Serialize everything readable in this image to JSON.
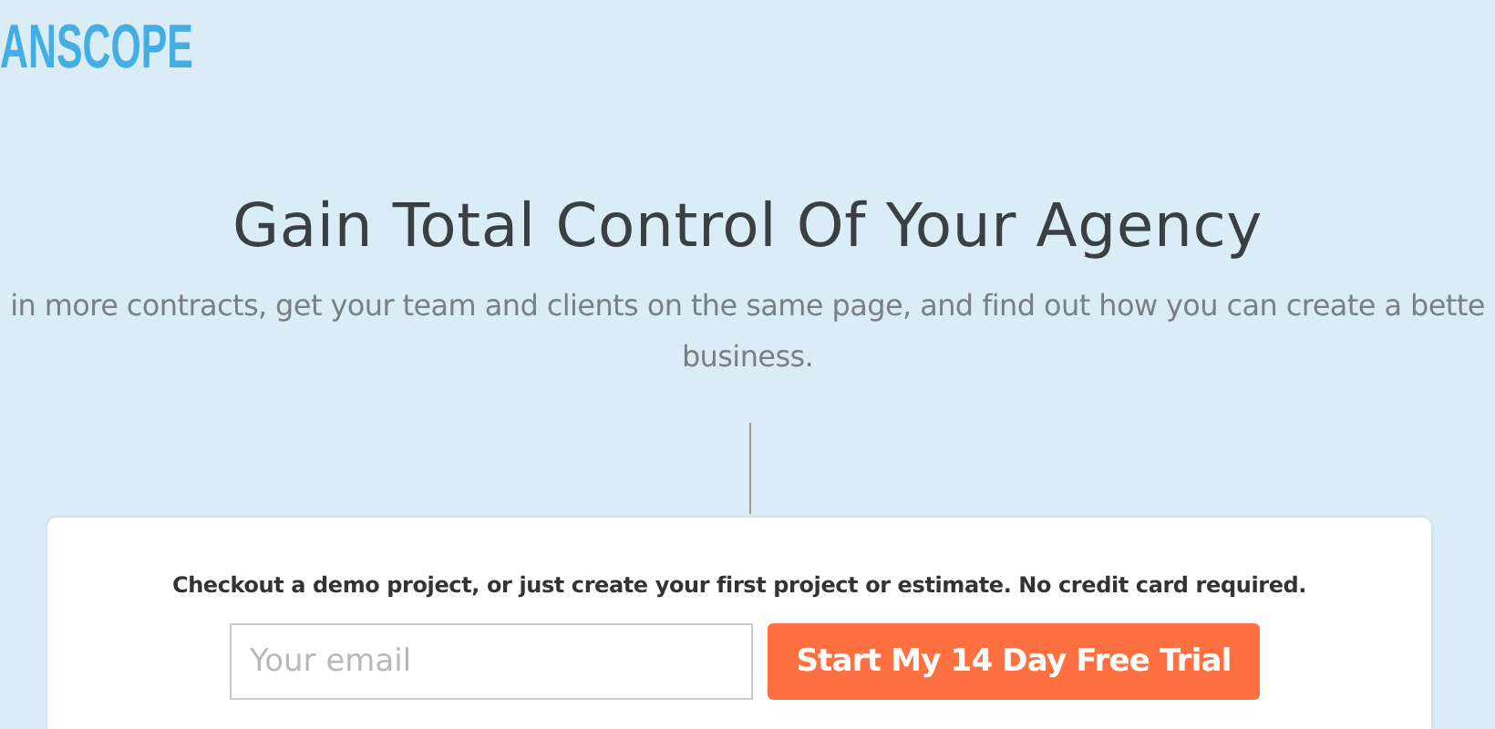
{
  "logo": {
    "text": "ANSCOPE"
  },
  "hero": {
    "title": "Gain Total Control Of Your Agency",
    "subtitle_lines": [
      "in more contracts, get your team and clients on the same page, and find out how you can create a bette",
      "business."
    ]
  },
  "signup": {
    "note": "Checkout a demo project, or just create your first project or estimate. No credit card required.",
    "email": {
      "placeholder": "Your email"
    },
    "button": "Start My 14 Day Free Trial"
  }
}
